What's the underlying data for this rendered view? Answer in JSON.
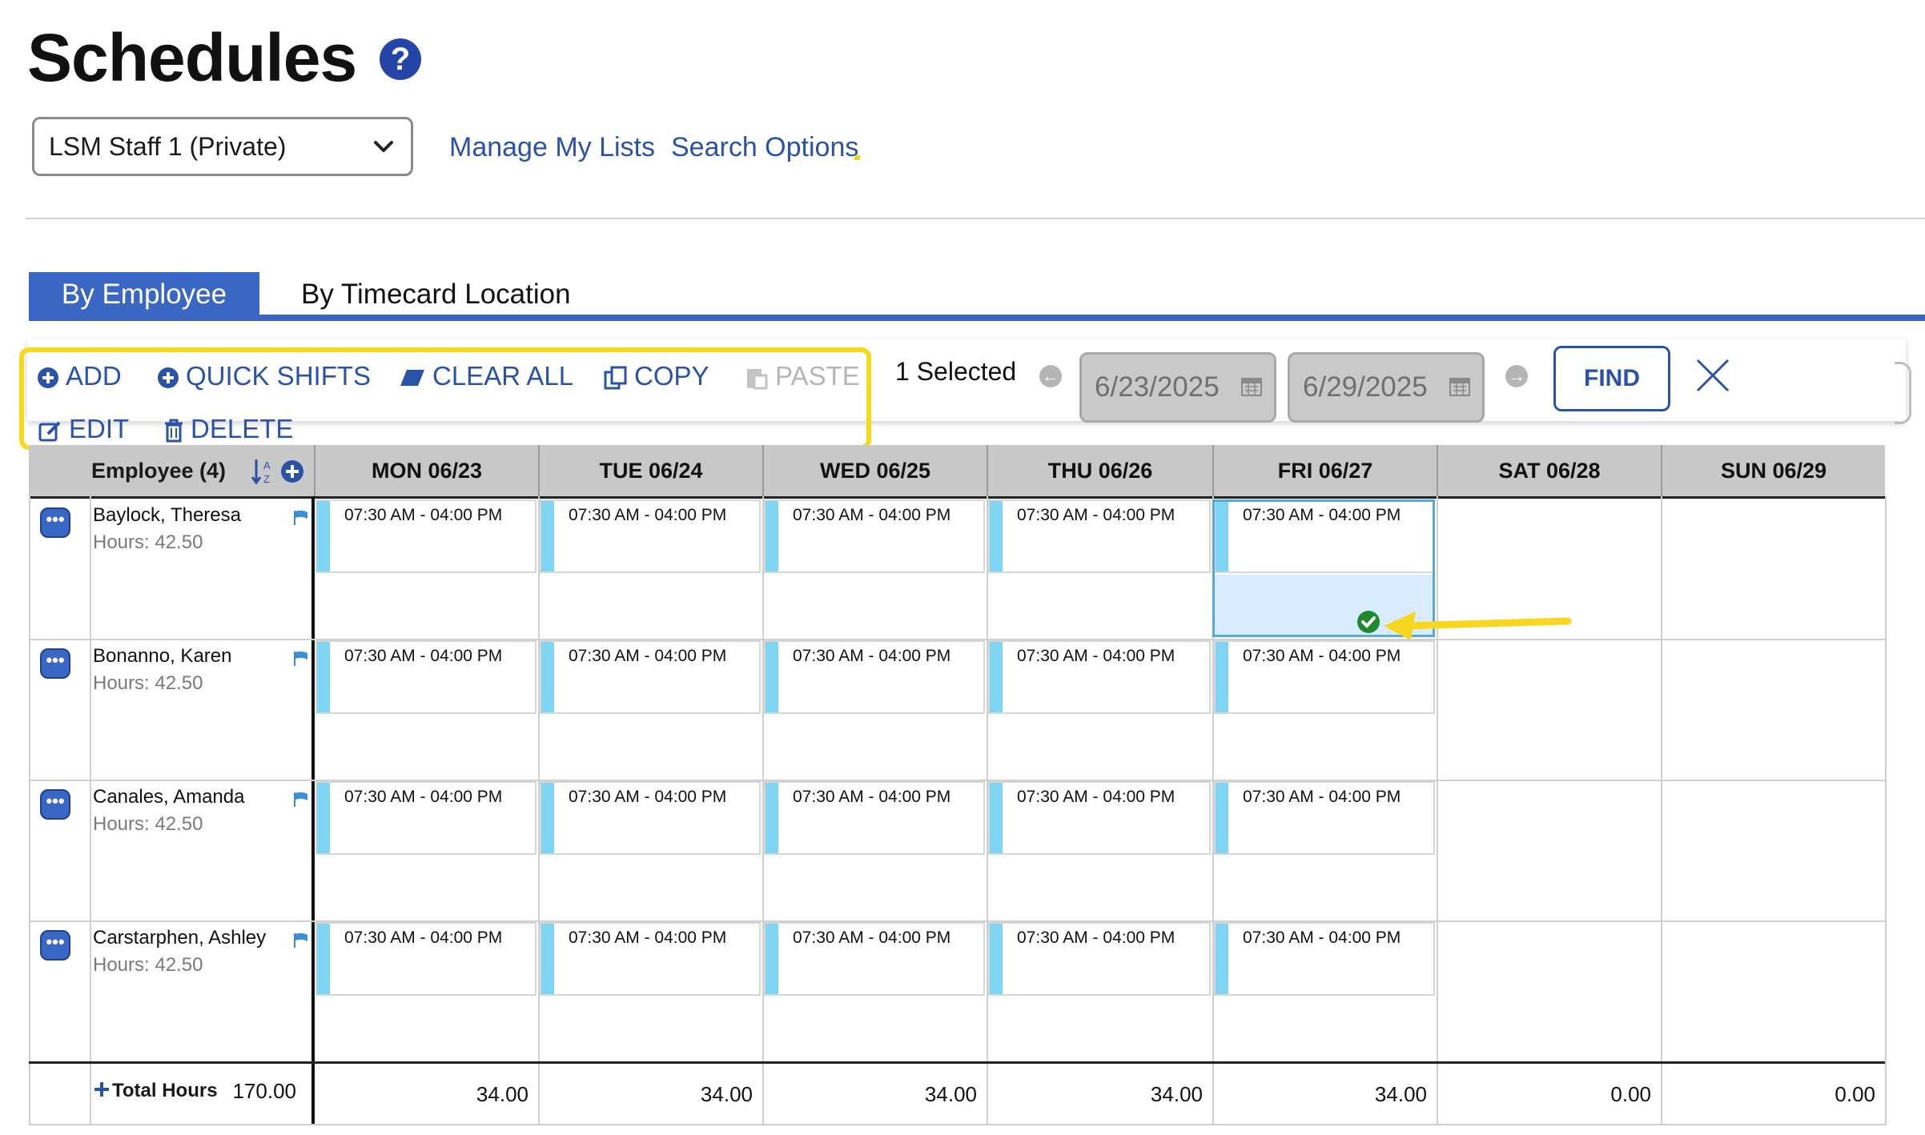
{
  "header": {
    "title": "Schedules",
    "help_icon": "?",
    "list_select_value": "LSM Staff 1 (Private)",
    "links": {
      "manage": "Manage My Lists",
      "search": "Search Options"
    }
  },
  "tabs": [
    {
      "label": "By Employee",
      "active": true
    },
    {
      "label": "By Timecard Location",
      "active": false
    }
  ],
  "toolbar": {
    "add": "ADD",
    "quick_shifts": "QUICK SHIFTS",
    "clear_all": "CLEAR ALL",
    "copy": "COPY",
    "paste": "PASTE",
    "edit": "EDIT",
    "delete": "DELETE",
    "selected": "1 Selected",
    "start_date": "6/23/2025",
    "end_date": "6/29/2025",
    "find": "FIND"
  },
  "grid": {
    "employee_header": "Employee (4)",
    "days": [
      "MON 06/23",
      "TUE 06/24",
      "WED 06/25",
      "THU 06/26",
      "FRI 06/27",
      "SAT 06/28",
      "SUN 06/29"
    ],
    "employees": [
      {
        "name": "Baylock, Theresa",
        "hours": "Hours: 42.50"
      },
      {
        "name": "Bonanno, Karen",
        "hours": "Hours: 42.50"
      },
      {
        "name": "Canales, Amanda",
        "hours": "Hours: 42.50"
      },
      {
        "name": "Carstarphen, Ashley",
        "hours": "Hours: 42.50"
      }
    ],
    "shift_time": "07:30 AM - 04:00 PM",
    "total_label": "Total Hours",
    "total_value": "170.00",
    "day_totals": [
      "34.00",
      "34.00",
      "34.00",
      "34.00",
      "34.00",
      "0.00",
      "0.00"
    ]
  },
  "colors": {
    "accent": "#3a67c4",
    "link": "#2a53a8",
    "highlight": "#f8d81e",
    "shift_bar": "#7fd6f2",
    "selected_cell": "#d9ebff",
    "check": "#1e8a2e"
  }
}
